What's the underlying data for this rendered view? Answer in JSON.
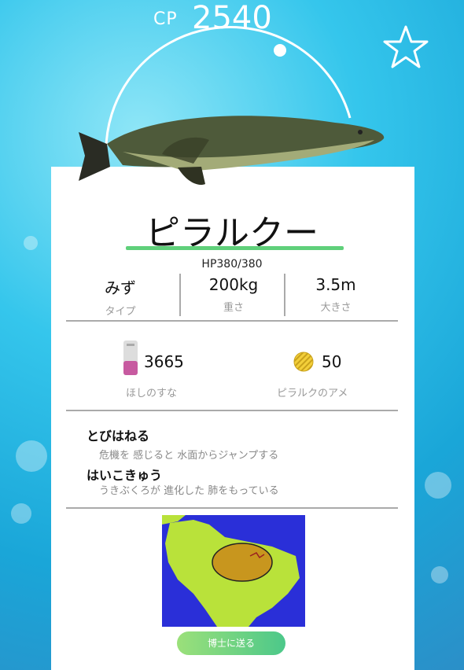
{
  "header": {
    "cp_label": "CP",
    "cp_value": "2540"
  },
  "pokemon": {
    "name": "ピラルクー",
    "hp": "HP380/380"
  },
  "stats": [
    {
      "value": "みず",
      "label": "タイプ"
    },
    {
      "value": "200kg",
      "label": "重さ"
    },
    {
      "value": "3.5m",
      "label": "大きさ"
    }
  ],
  "resources": {
    "stardust": {
      "value": "3665",
      "label": "ほしのすな"
    },
    "candy": {
      "value": "50",
      "label": "ピラルクのアメ"
    }
  },
  "moves": [
    {
      "name": "とびはねる",
      "desc": "危機を 感じると 水面からジャンプする"
    },
    {
      "name": "はいこきゅう",
      "desc": "うきぶくろが 進化した 肺をもっている"
    }
  ],
  "actions": {
    "send_label": "博士に送る"
  },
  "colors": {
    "accent_green": "#5fd07a",
    "map_ocean": "#2a2fd8",
    "map_land": "#b9e23a",
    "habitat": "#c8961e"
  },
  "icons": [
    "star-icon",
    "stardust-icon",
    "candy-icon",
    "habitat-map"
  ]
}
